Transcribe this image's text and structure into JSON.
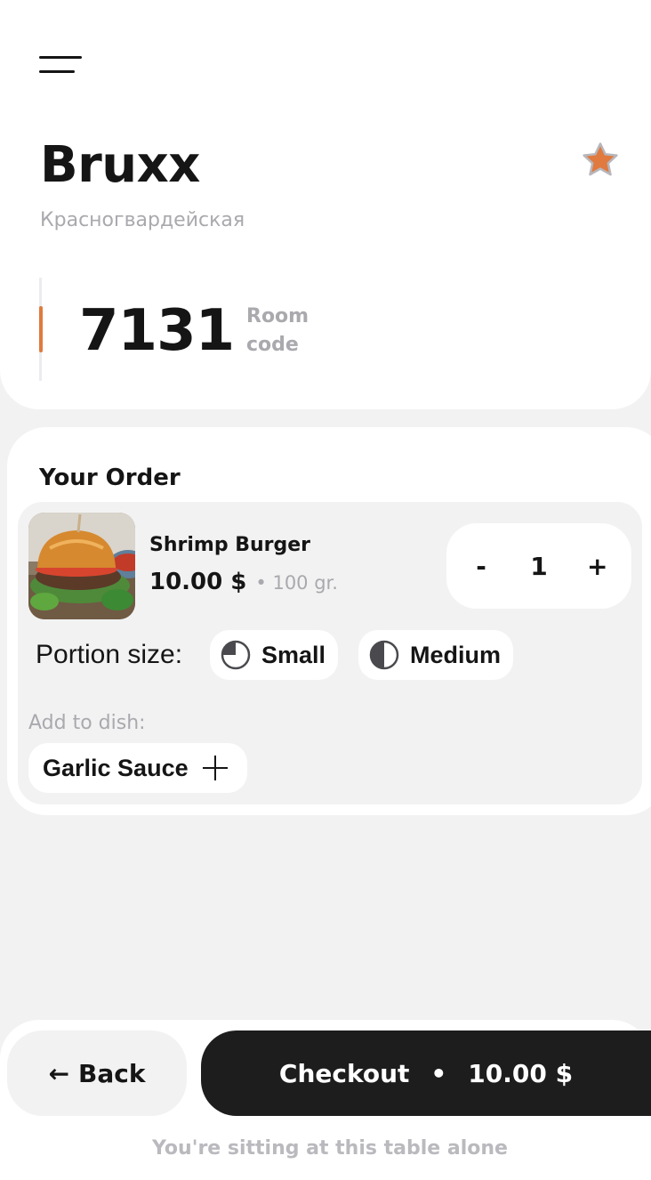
{
  "restaurant": {
    "name": "Bruxx",
    "location": "Красногвардейская"
  },
  "room": {
    "code": "7131",
    "label": "Room code"
  },
  "order": {
    "title": "Your Order",
    "items": [
      {
        "name": "Shrimp Burger",
        "price": "10.00 $",
        "weight": "• 100 gr.",
        "quantity": "1",
        "decrement_label": "-",
        "increment_label": "+",
        "portion_label": "Portion size:",
        "portions": [
          {
            "label": "Small",
            "icon": "quarter-pie-icon"
          },
          {
            "label": "Medium",
            "icon": "half-pie-icon"
          }
        ],
        "addons_label": "Add to dish:",
        "addons": [
          {
            "label": "Garlic Sauce",
            "icon": "plus-icon"
          }
        ]
      }
    ]
  },
  "footer": {
    "back_arrow": "←",
    "back_label": "Back",
    "checkout_label": "Checkout",
    "checkout_separator": "•",
    "checkout_total": "10.00 $",
    "status": "You're sitting at this table alone"
  },
  "colors": {
    "accent": "#e07a3f",
    "dark": "#1d1d1d",
    "muted": "#a9a9ae",
    "background": "#f2f2f3"
  }
}
